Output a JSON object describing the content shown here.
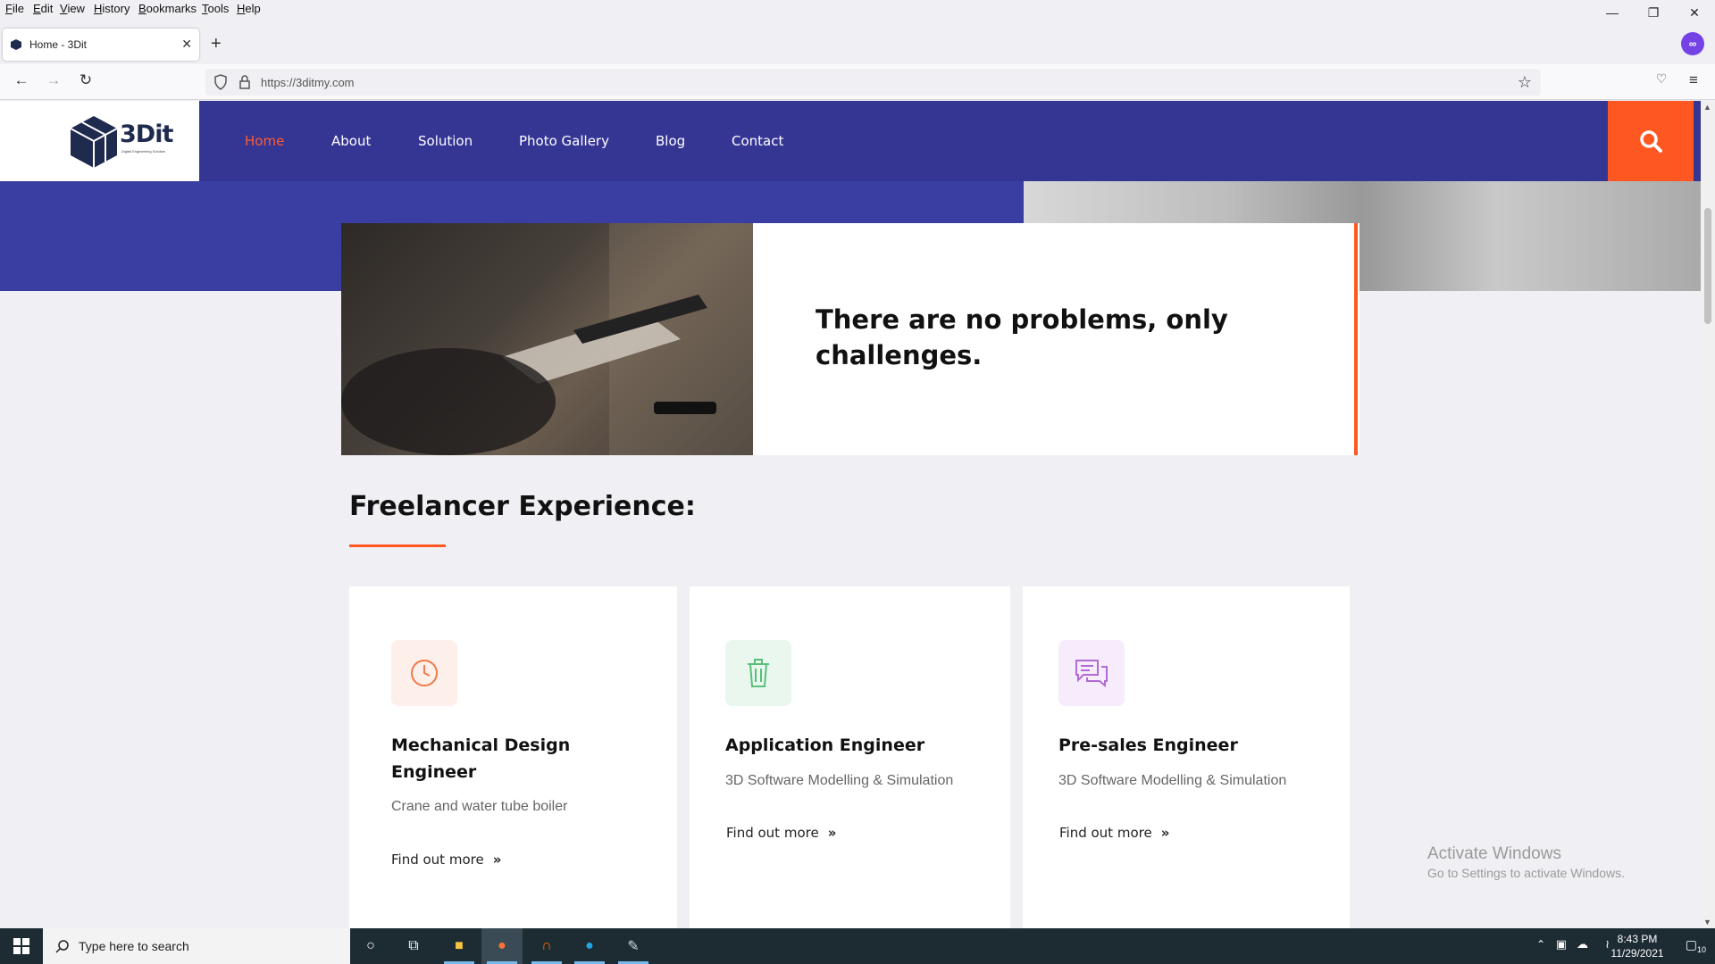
{
  "menubar": {
    "items": [
      "File",
      "Edit",
      "View",
      "History",
      "Bookmarks",
      "Tools",
      "Help"
    ]
  },
  "browser": {
    "tab_title": "Home - 3Dit",
    "url": "https://3ditmy.com"
  },
  "site": {
    "logo_text": "3Dit",
    "logo_tagline": "Digital Engineering Solution",
    "nav": [
      "Home",
      "About",
      "Solution",
      "Photo Gallery",
      "Blog",
      "Contact"
    ],
    "active_nav": "Home",
    "quote": "There are no problems, only challenges.",
    "section_title": "Freelancer Experience:",
    "cards": [
      {
        "icon": "clock-icon",
        "title": "Mechanical Design Engineer",
        "subtitle": "Crane and water tube boiler",
        "link": "Find out more"
      },
      {
        "icon": "trash-icon",
        "title": "Application Engineer",
        "subtitle": "3D Software Modelling & Simulation",
        "link": "Find out more"
      },
      {
        "icon": "chat-icon",
        "title": "Pre-sales Engineer",
        "subtitle": "3D Software Modelling & Simulation",
        "link": "Find out more"
      }
    ],
    "colors": {
      "brand_blue": "#353594",
      "accent_orange": "#ff5722"
    }
  },
  "watermark": {
    "line1": "Activate Windows",
    "line2": "Go to Settings to activate Windows."
  },
  "taskbar": {
    "search_placeholder": "Type here to search",
    "time": "8:43 PM",
    "date": "11/29/2021",
    "notification_count": "10"
  }
}
